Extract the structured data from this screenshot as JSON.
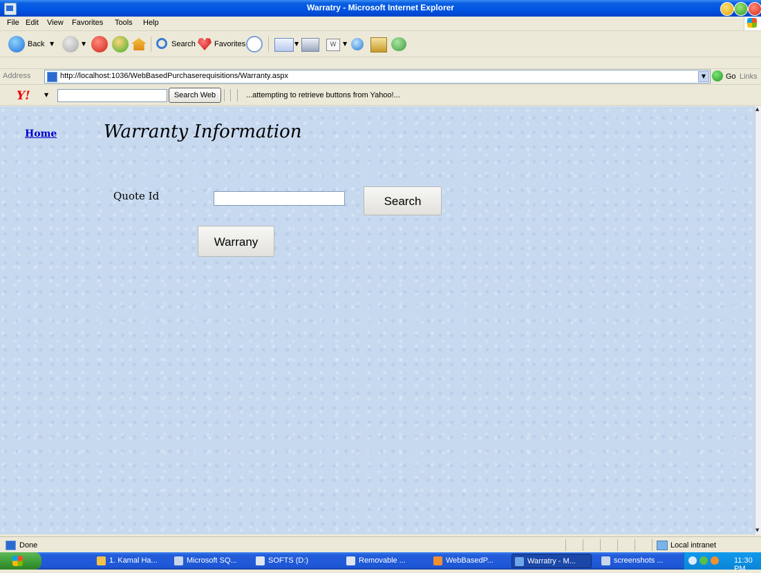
{
  "window": {
    "title": "Warratry - Microsoft Internet Explorer"
  },
  "menubar": {
    "items": [
      "File",
      "Edit",
      "View",
      "Favorites",
      "Tools",
      "Help"
    ]
  },
  "toolbar": {
    "back_label": "Back",
    "search_label": "Search",
    "favorites_label": "Favorites"
  },
  "addressbar": {
    "label": "Address",
    "url": "http://localhost:1036/WebBasedPurchaserequisitions/Warranty.aspx",
    "go_label": "Go",
    "links_label": "Links"
  },
  "yahoo": {
    "logo": "Y!",
    "search_web_label": "Search Web",
    "status": "...attempting to retrieve buttons from Yahoo!..."
  },
  "page": {
    "home_link": "Home",
    "title": "Warranty Information",
    "quote_label": "Quote Id",
    "quote_value": "",
    "search_button": "Search",
    "warranty_button": "Warrany"
  },
  "statusbar": {
    "text": "Done",
    "zone": "Local intranet"
  },
  "taskbar": {
    "items": [
      "1. Kamal Ha...",
      "Microsoft SQ...",
      "SOFTS (D:)",
      "Removable ...",
      "WebBasedP...",
      "Warratry - M...",
      "screenshots ..."
    ],
    "clock": "11:30 PM"
  },
  "colors": {
    "title_bar": "#0054e3",
    "content_bg": "#c7d9ef",
    "link": "#0000cc",
    "taskbar": "#245edb",
    "start_button": "#3b9a36"
  }
}
